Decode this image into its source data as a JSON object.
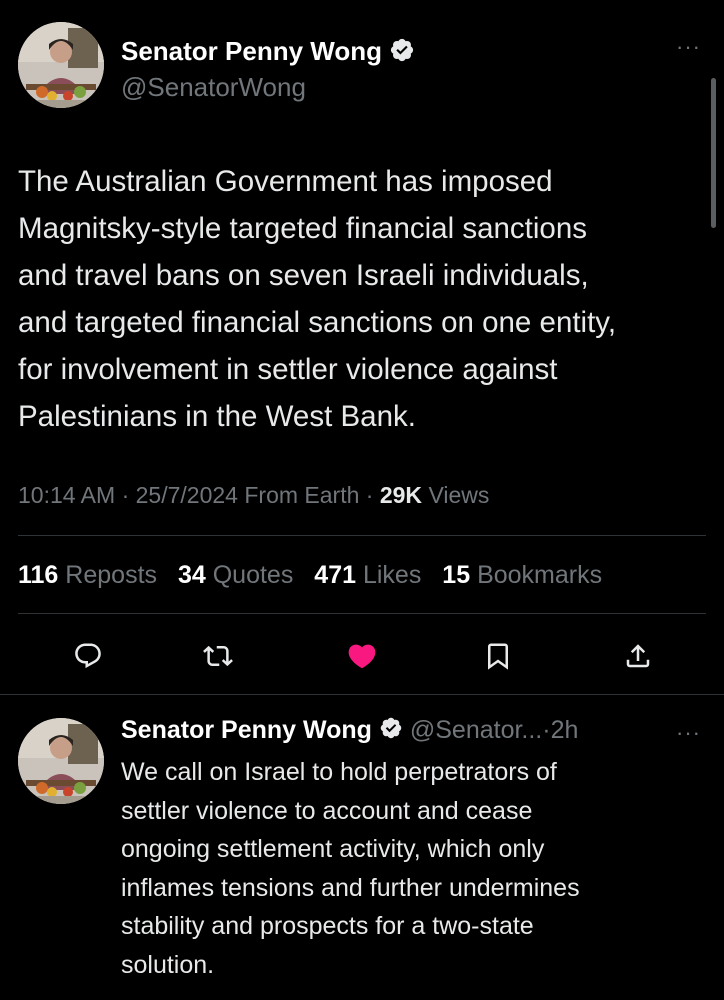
{
  "main_tweet": {
    "author": {
      "name": "Senator Penny Wong",
      "handle": "@SenatorWong",
      "verified": true,
      "avatar_icon": "avatar-photo-icon"
    },
    "more_label": "···",
    "text": "The Australian Government has imposed\nMagnitsky-style targeted financial sanctions\nand travel bans on seven Israeli individuals,\nand targeted financial sanctions on one entity,\nfor involvement in settler violence against\nPalestinians in the West Bank.",
    "meta": {
      "time": "10:14 AM",
      "sep1": "·",
      "date": "25/7/2024",
      "source": "From Earth",
      "sep2": "·",
      "views_count": "29K",
      "views_label": "Views"
    },
    "stats": [
      {
        "count": "116",
        "label": "Reposts"
      },
      {
        "count": "34",
        "label": "Quotes"
      },
      {
        "count": "471",
        "label": "Likes"
      },
      {
        "count": "15",
        "label": "Bookmarks"
      }
    ],
    "actions": [
      {
        "icon": "reply-icon"
      },
      {
        "icon": "repost-icon"
      },
      {
        "icon": "like-heart-icon",
        "active": true,
        "color": "#f91880"
      },
      {
        "icon": "bookmark-icon"
      },
      {
        "icon": "share-icon"
      }
    ]
  },
  "reply_tweet": {
    "author": {
      "name": "Senator Penny Wong",
      "handle": "@Senator...",
      "sep": "·",
      "time": "2h",
      "verified": true
    },
    "more_label": "···",
    "text": "We call on Israel to hold perpetrators of\nsettler violence to account and cease\nongoing settlement activity, which only\ninflames tensions and further undermines\nstability and prospects for a two-state\nsolution."
  },
  "colors": {
    "background": "#000000",
    "text": "#e7e9ea",
    "muted": "#71767b",
    "divider": "#2f3336",
    "like": "#f91880",
    "verified_badge": "#e7e9ea"
  }
}
